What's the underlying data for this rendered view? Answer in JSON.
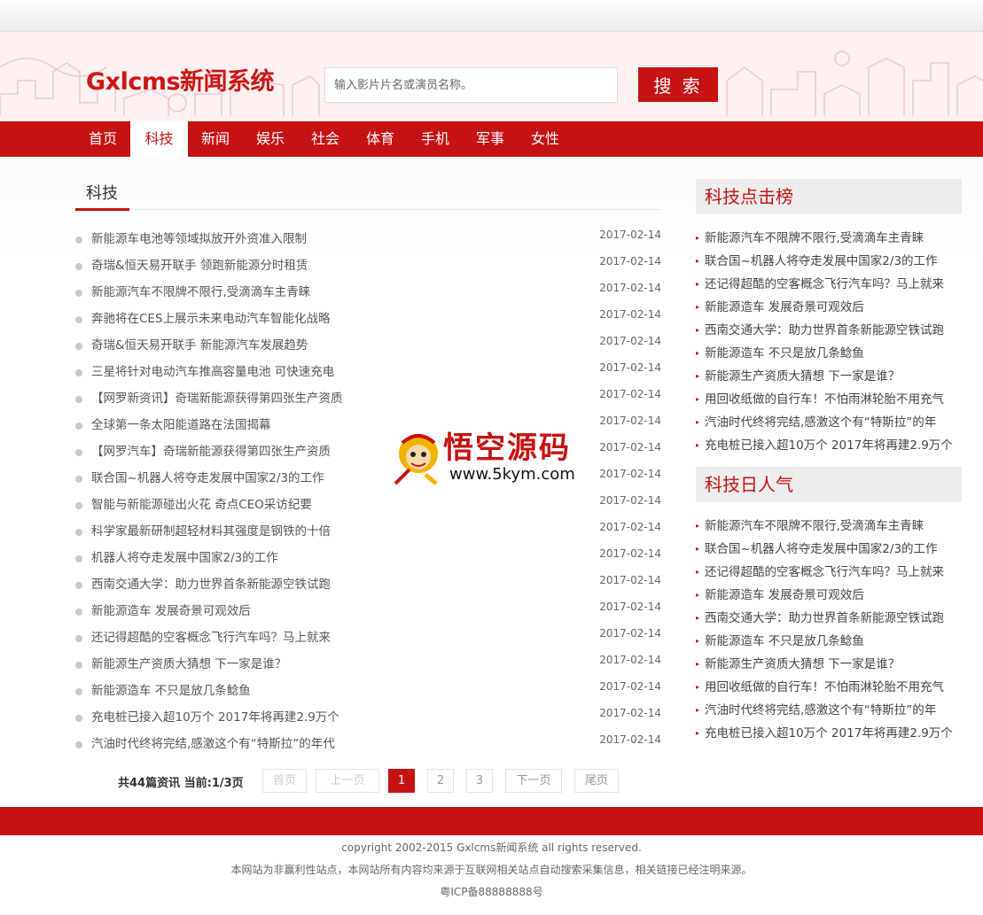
{
  "header": {
    "logo": "Gxlcms新闻系统",
    "search_placeholder": "输入影片片名或演员名称。",
    "search_button": "搜 索"
  },
  "nav": [
    "首页",
    "科技",
    "新闻",
    "娱乐",
    "社会",
    "体育",
    "手机",
    "军事",
    "女性"
  ],
  "nav_active": "科技",
  "section": {
    "title": "科技"
  },
  "news": [
    {
      "title": "新能源车电池等领域拟放开外资准入限制",
      "date": "2017-02-14"
    },
    {
      "title": "奇瑞&恒天易开联手 领跑新能源分时租赁",
      "date": "2017-02-14"
    },
    {
      "title": "新能源汽车不限牌不限行,受滴滴车主青睐",
      "date": "2017-02-14"
    },
    {
      "title": "奔驰将在CES上展示未来电动汽车智能化战略",
      "date": "2017-02-14"
    },
    {
      "title": "奇瑞&恒天易开联手 新能源汽车发展趋势",
      "date": "2017-02-14"
    },
    {
      "title": "三星将针对电动汽车推高容量电池 可快速充电",
      "date": "2017-02-14"
    },
    {
      "title": "【网罗新资讯】奇瑞新能源获得第四张生产资质",
      "date": "2017-02-14"
    },
    {
      "title": "全球第一条太阳能道路在法国揭幕",
      "date": "2017-02-14"
    },
    {
      "title": "【网罗汽车】奇瑞新能源获得第四张生产资质",
      "date": "2017-02-14"
    },
    {
      "title": "联合国~机器人将夺走发展中国家2/3的工作",
      "date": "2017-02-14"
    },
    {
      "title": "智能与新能源碰出火花 奇点CEO采访纪要",
      "date": "2017-02-14"
    },
    {
      "title": "科学家最新研制超轻材料其强度是钢铁的十倍",
      "date": "2017-02-14"
    },
    {
      "title": "机器人将夺走发展中国家2/3的工作",
      "date": "2017-02-14"
    },
    {
      "title": "西南交通大学：助力世界首条新能源空铁试跑",
      "date": "2017-02-14"
    },
    {
      "title": "新能源造车 发展奇景可观效后",
      "date": "2017-02-14"
    },
    {
      "title": "还记得超酷的空客概念飞行汽车吗？马上就来",
      "date": "2017-02-14"
    },
    {
      "title": "新能源生产资质大猜想 下一家是谁？",
      "date": "2017-02-14"
    },
    {
      "title": "新能源造车 不只是放几条鲶鱼",
      "date": "2017-02-14"
    },
    {
      "title": "充电桩已接入超10万个 2017年将再建2.9万个",
      "date": "2017-02-14"
    },
    {
      "title": "汽油时代终将完结,感激这个有“特斯拉”的年代",
      "date": "2017-02-14"
    }
  ],
  "pagination": {
    "info": "共44篇资讯 当前:1/3页",
    "first": "首页",
    "prev": "上一页",
    "pages": [
      "1",
      "2",
      "3"
    ],
    "current": "1",
    "next": "下一页",
    "last": "尾页"
  },
  "sidebar": {
    "hot_title": "科技点击榜",
    "hot_items": [
      "新能源汽车不限牌不限行,受滴滴车主青睐",
      "联合国~机器人将夺走发展中国家2/3的工作",
      "还记得超酷的空客概念飞行汽车吗？马上就来",
      "新能源造车 发展奇景可观效后",
      "西南交通大学：助力世界首条新能源空铁试跑",
      "新能源造车 不只是放几条鲶鱼",
      "新能源生产资质大猜想 下一家是谁？",
      "用回收纸做的自行车！不怕雨淋轮胎不用充气",
      "汽油时代终将完结,感激这个有“特斯拉”的年",
      "充电桩已接入超10万个 2017年将再建2.9万个"
    ],
    "daily_title": "科技日人气",
    "daily_items": [
      "新能源汽车不限牌不限行,受滴滴车主青睐",
      "联合国~机器人将夺走发展中国家2/3的工作",
      "还记得超酷的空客概念飞行汽车吗？马上就来",
      "新能源造车 发展奇景可观效后",
      "西南交通大学：助力世界首条新能源空铁试跑",
      "新能源造车 不只是放几条鲶鱼",
      "新能源生产资质大猜想 下一家是谁？",
      "用回收纸做的自行车！不怕雨淋轮胎不用充气",
      "汽油时代终将完结,感激这个有“特斯拉”的年",
      "充电桩已接入超10万个 2017年将再建2.9万个"
    ]
  },
  "watermark": {
    "name": "悟空源码",
    "url": "www.5kym.com"
  },
  "footer": {
    "copyright": "copyright 2002-2015 Gxlcms新闻系统 all rights reserved.",
    "disclaimer": "本网站为非赢利性站点，本网站所有内容均来源于互联网相关站点自动搜索采集信息，相关链接已经注明来源。",
    "icp": "粤ICP备88888888号"
  },
  "colors": {
    "brand": "#c51212",
    "header_bg": "#fdf1f1",
    "sidebar_title_bg": "#ededed"
  }
}
